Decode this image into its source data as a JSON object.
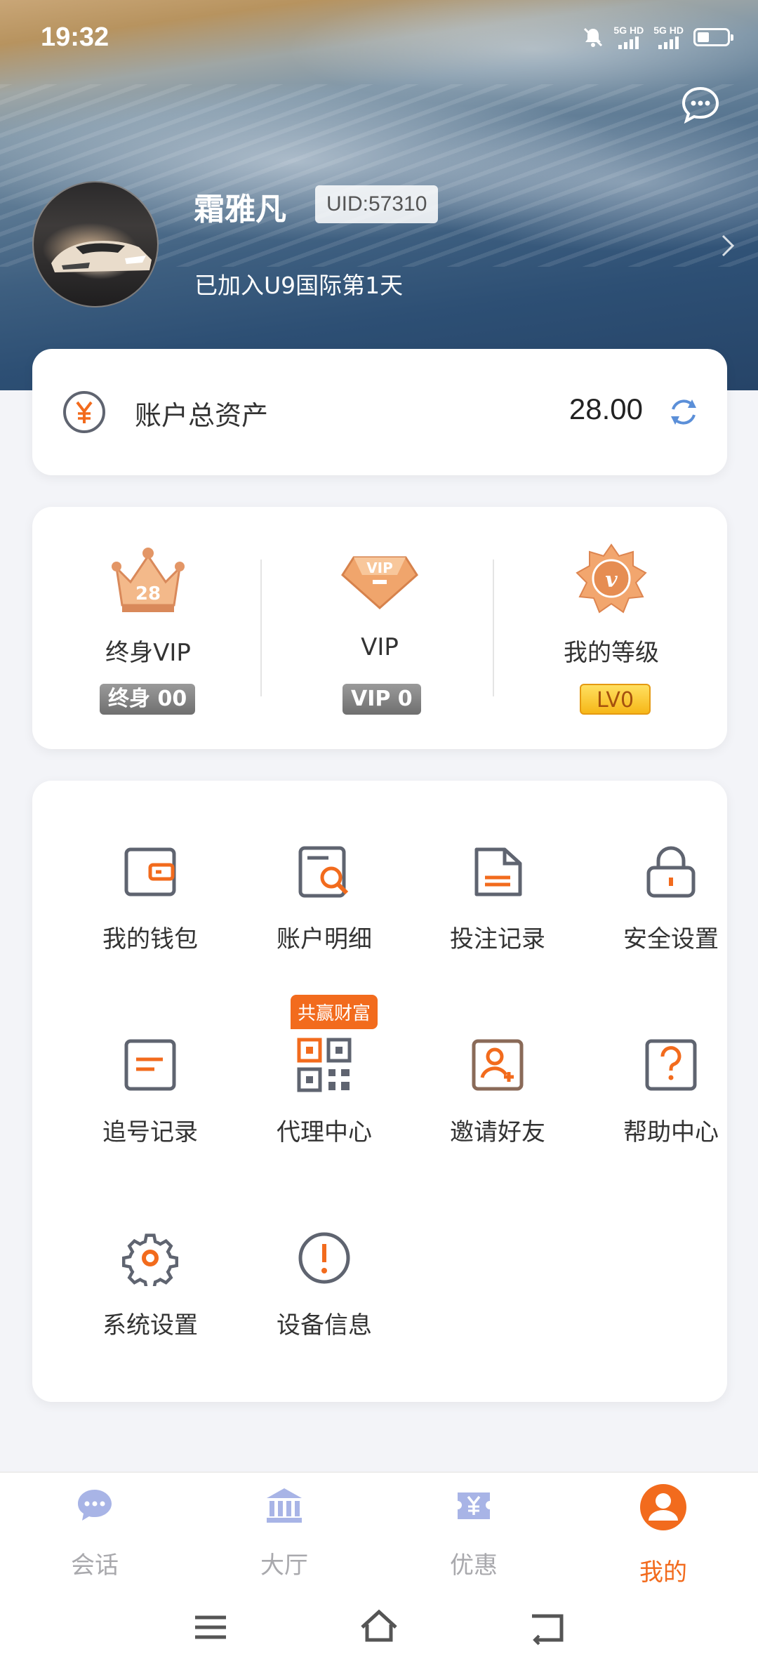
{
  "status_bar": {
    "time": "19:32",
    "signal1_label": "5G HD",
    "signal2_label": "5G HD"
  },
  "profile": {
    "username": "霜雅凡",
    "uid": "UID:57310",
    "joined_text": "已加入U9国际第1天"
  },
  "assets": {
    "label": "账户总资产",
    "value": "28.00"
  },
  "vip": [
    {
      "title": "终身VIP",
      "badge": "终身 00",
      "icon": "crown-icon"
    },
    {
      "title": "VIP",
      "badge": "VIP 0",
      "icon": "vip-diamond-icon"
    },
    {
      "title": "我的等级",
      "badge": "LV0",
      "icon": "level-medal-icon"
    }
  ],
  "menu": {
    "promo_tag": "共赢财富",
    "items": [
      {
        "label": "我的钱包",
        "icon": "wallet-icon"
      },
      {
        "label": "账户明细",
        "icon": "account-details-icon"
      },
      {
        "label": "投注记录",
        "icon": "bet-record-icon"
      },
      {
        "label": "安全设置",
        "icon": "lock-icon"
      },
      {
        "label": "追号记录",
        "icon": "chase-record-icon"
      },
      {
        "label": "代理中心",
        "icon": "qr-code-icon"
      },
      {
        "label": "邀请好友",
        "icon": "invite-friend-icon"
      },
      {
        "label": "帮助中心",
        "icon": "help-icon"
      },
      {
        "label": "系统设置",
        "icon": "gear-icon"
      },
      {
        "label": "设备信息",
        "icon": "info-icon"
      }
    ]
  },
  "bottom_nav": [
    {
      "label": "会话",
      "icon": "chat-icon"
    },
    {
      "label": "大厅",
      "icon": "hall-icon"
    },
    {
      "label": "优惠",
      "icon": "promo-icon"
    },
    {
      "label": "我的",
      "icon": "profile-icon",
      "active": true
    }
  ],
  "colors": {
    "accent": "#f26b1d",
    "icon_grey": "#5f6470",
    "nav_inactive": "#a9a9ad",
    "background": "#f3f4f8"
  }
}
